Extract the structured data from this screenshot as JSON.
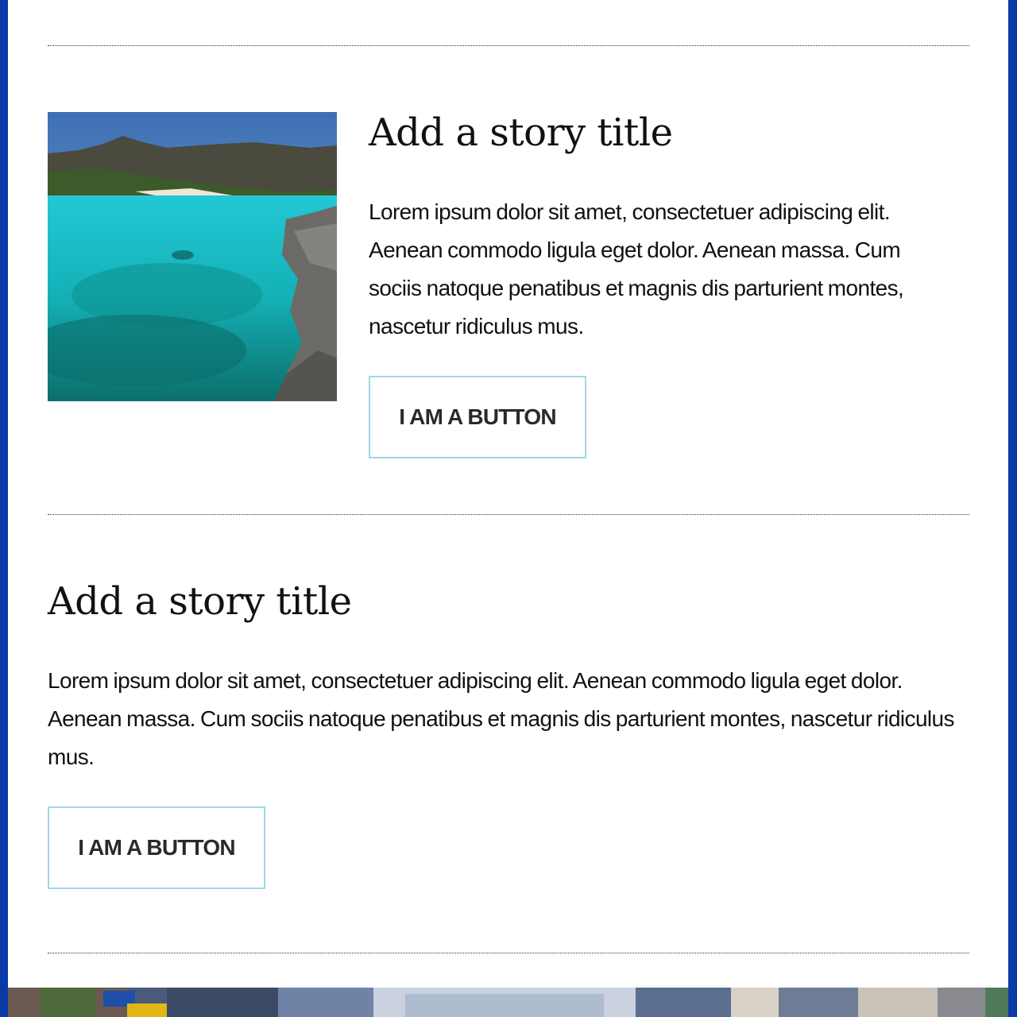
{
  "stories": [
    {
      "title": "Add a story title",
      "body": "Lorem ipsum dolor sit amet, consectetuer adipiscing elit. Aenean commodo ligula eget dolor. Aenean massa. Cum sociis natoque penatibus et magnis dis parturient montes, nascetur ridiculus mus.",
      "button_label": "I AM A BUTTON"
    },
    {
      "title": "Add a story title",
      "body": "Lorem ipsum dolor sit amet, consectetuer adipiscing elit. Aenean commodo ligula eget dolor. Aenean massa. Cum sociis natoque penatibus et magnis dis parturient montes, nascetur ridiculus mus.",
      "button_label": "I AM A BUTTON"
    }
  ],
  "colors": {
    "page_background": "#0a3aa8",
    "content_background": "#ffffff",
    "button_border": "#9fd8e6",
    "text": "#111111"
  }
}
